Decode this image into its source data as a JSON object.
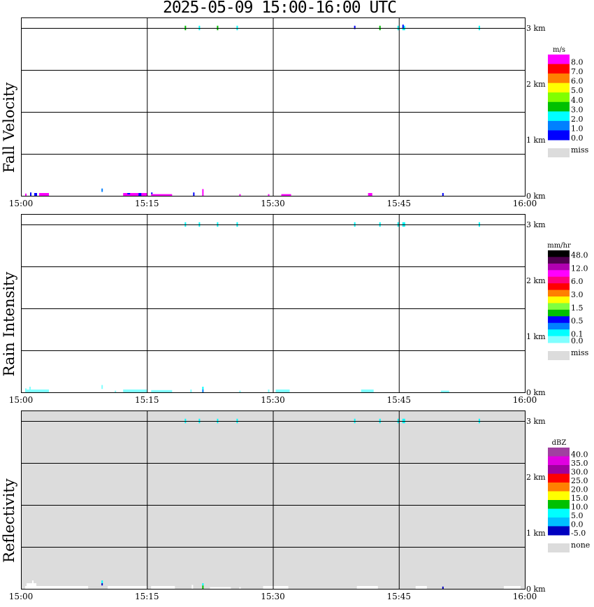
{
  "title": "2025-05-09   15:00-16:00 UTC",
  "chart_data": [
    {
      "type": "heatmap",
      "title": "Fall Velocity",
      "xlim": [
        "15:00",
        "16:00"
      ],
      "x_ticks": [
        "15:00",
        "15:15",
        "15:30",
        "15:45",
        "16:00"
      ],
      "ylim": [
        0,
        3.19
      ],
      "y_ticks": [
        "0 km",
        "1 km",
        "2 km",
        "3 km"
      ],
      "grid": true,
      "legend": {
        "unit": "m/s",
        "levels": [
          {
            "color": "#ff00ff",
            "label": "8.0",
            "min": 8
          },
          {
            "color": "#ff0000",
            "label": "7.0",
            "min": 7
          },
          {
            "color": "#ff8000",
            "label": "6.0",
            "min": 6
          },
          {
            "color": "#ffff00",
            "label": "5.0",
            "min": 5
          },
          {
            "color": "#80ff00",
            "label": "4.0",
            "min": 4
          },
          {
            "color": "#00c000",
            "label": "3.0",
            "min": 3
          },
          {
            "color": "#00ffff",
            "label": "2.0",
            "min": 2
          },
          {
            "color": "#0080ff",
            "label": "1.0",
            "min": 1
          },
          {
            "color": "#0000ff",
            "label": "0.0",
            "min": 0
          }
        ],
        "missing": {
          "color": "#dcdcdc",
          "label": "miss"
        },
        "below_color": "#ffffff"
      },
      "background": "#ffffff",
      "cells": [
        [
          "15:00:30",
          "15:00:40",
          0,
          0.04,
          8.5
        ],
        [
          "15:01:05",
          "15:01:15",
          0,
          0.06,
          0.5
        ],
        [
          "15:01:35",
          "15:01:55",
          0,
          0.05,
          0.5
        ],
        [
          "15:02:10",
          "15:03:20",
          0,
          0.05,
          8.5
        ],
        [
          "15:09:35",
          "15:09:45",
          0.07,
          0.13,
          1.5
        ],
        [
          "15:12:10",
          "15:15:00",
          0,
          0.05,
          8.5
        ],
        [
          "15:12:40",
          "15:13:00",
          0.03,
          0.05,
          0.5
        ],
        [
          "15:14:00",
          "15:14:20",
          0,
          0.05,
          0.5
        ],
        [
          "15:15:30",
          "15:18:00",
          0,
          0.03,
          8.5
        ],
        [
          "15:15:30",
          "15:15:40",
          0.03,
          0.06,
          0.5
        ],
        [
          "15:20:30",
          "15:20:40",
          0,
          0.06,
          0.5
        ],
        [
          "15:21:35",
          "15:21:45",
          0,
          0.12,
          8.5
        ],
        [
          "15:26:00",
          "15:26:10",
          0,
          0.03,
          8.5
        ],
        [
          "15:29:25",
          "15:29:35",
          0,
          0.03,
          8.5
        ],
        [
          "15:31:00",
          "15:32:10",
          0,
          0.03,
          8.5
        ],
        [
          "15:41:20",
          "15:41:50",
          0,
          0.05,
          8.5
        ],
        [
          "15:50:10",
          "15:50:20",
          0,
          0.05,
          0.5
        ],
        [
          "15:19:30",
          "15:19:40",
          2.96,
          3.04,
          3.5
        ],
        [
          "15:21:10",
          "15:21:20",
          2.96,
          3.04,
          2.5
        ],
        [
          "15:23:20",
          "15:23:30",
          2.96,
          3.04,
          3.5
        ],
        [
          "15:25:40",
          "15:25:50",
          2.96,
          3.04,
          2.5
        ],
        [
          "15:39:40",
          "15:39:50",
          2.98,
          3.04,
          0.5
        ],
        [
          "15:42:40",
          "15:42:50",
          2.96,
          3.04,
          3.5
        ],
        [
          "15:44:50",
          "15:45:00",
          2.96,
          3.04,
          2.5
        ],
        [
          "15:45:25",
          "15:45:45",
          2.96,
          3.04,
          2.5
        ],
        [
          "15:45:25",
          "15:45:35",
          3.0,
          3.06,
          0.5
        ],
        [
          "15:54:30",
          "15:54:40",
          2.96,
          3.04,
          2.5
        ]
      ]
    },
    {
      "type": "heatmap",
      "title": "Rain Intensity",
      "xlim": [
        "15:00",
        "16:00"
      ],
      "x_ticks": [
        "15:00",
        "15:15",
        "15:30",
        "15:45",
        "16:00"
      ],
      "ylim": [
        0,
        3.19
      ],
      "y_ticks": [
        "0 km",
        "1 km",
        "2 km",
        "3 km"
      ],
      "grid": true,
      "legend": {
        "unit": "mm/hr",
        "levels": [
          {
            "color": "#000000",
            "label": "48.0",
            "min": 48
          },
          {
            "color": "#500050",
            "label": "",
            "min": 24
          },
          {
            "color": "#b000b0",
            "label": "12.0",
            "min": 12
          },
          {
            "color": "#ff00ff",
            "label": "",
            "min": 9
          },
          {
            "color": "#ff0080",
            "label": "6.0",
            "min": 6
          },
          {
            "color": "#ff0000",
            "label": "",
            "min": 4.5
          },
          {
            "color": "#ff8000",
            "label": "3.0",
            "min": 3
          },
          {
            "color": "#ffff00",
            "label": "",
            "min": 2
          },
          {
            "color": "#80ff40",
            "label": "1.5",
            "min": 1.5
          },
          {
            "color": "#00c000",
            "label": "",
            "min": 1
          },
          {
            "color": "#0000ff",
            "label": "0.5",
            "min": 0.5
          },
          {
            "color": "#0080ff",
            "label": "",
            "min": 0.3
          },
          {
            "color": "#00ffff",
            "label": "0.1",
            "min": 0.1
          },
          {
            "color": "#80ffff",
            "label": "0.0",
            "min": 0
          }
        ],
        "missing": {
          "color": "#dcdcdc",
          "label": "miss"
        },
        "below_color": "#ffffff"
      },
      "background": "#ffffff",
      "cells": [
        [
          "15:00:30",
          "15:00:40",
          0,
          0.07,
          0.05
        ],
        [
          "15:00:40",
          "15:03:20",
          0,
          0.05,
          0.05
        ],
        [
          "15:01:00",
          "15:01:10",
          0.05,
          0.1,
          0.05
        ],
        [
          "15:09:35",
          "15:09:45",
          0.06,
          0.13,
          0.05
        ],
        [
          "15:11:10",
          "15:11:20",
          0,
          0.03,
          0.05
        ],
        [
          "15:12:10",
          "15:15:00",
          0,
          0.05,
          0.05
        ],
        [
          "15:15:30",
          "15:18:00",
          0,
          0.04,
          0.05
        ],
        [
          "15:20:10",
          "15:20:20",
          0,
          0.05,
          0.05
        ],
        [
          "15:21:35",
          "15:21:45",
          0,
          0.05,
          0.4
        ],
        [
          "15:21:35",
          "15:21:45",
          0.05,
          0.1,
          0.2
        ],
        [
          "15:26:00",
          "15:26:10",
          0,
          0.03,
          0.05
        ],
        [
          "15:29:25",
          "15:29:35",
          0,
          0.05,
          0.05
        ],
        [
          "15:30:20",
          "15:32:00",
          0,
          0.05,
          0.05
        ],
        [
          "15:40:30",
          "15:42:00",
          0,
          0.05,
          0.05
        ],
        [
          "15:50:00",
          "15:51:00",
          0,
          0.03,
          0.05
        ],
        [
          "15:19:30",
          "15:19:40",
          2.96,
          3.04,
          0.2
        ],
        [
          "15:21:10",
          "15:21:20",
          2.96,
          3.04,
          0.2
        ],
        [
          "15:23:20",
          "15:23:30",
          2.96,
          3.04,
          0.2
        ],
        [
          "15:25:40",
          "15:25:50",
          2.96,
          3.04,
          0.2
        ],
        [
          "15:39:40",
          "15:39:50",
          2.96,
          3.04,
          0.2
        ],
        [
          "15:42:40",
          "15:42:50",
          2.96,
          3.04,
          0.2
        ],
        [
          "15:44:50",
          "15:45:00",
          2.96,
          3.04,
          0.2
        ],
        [
          "15:45:25",
          "15:45:45",
          2.96,
          3.04,
          0.2
        ],
        [
          "15:54:30",
          "15:54:40",
          2.96,
          3.04,
          0.2
        ]
      ]
    },
    {
      "type": "heatmap",
      "title": "Reflectivity",
      "xlim": [
        "15:00",
        "16:00"
      ],
      "x_ticks": [
        "15:00",
        "15:15",
        "15:30",
        "15:45",
        "16:00"
      ],
      "ylim": [
        0,
        3.19
      ],
      "y_ticks": [
        "0 km",
        "1 km",
        "2 km",
        "3 km"
      ],
      "grid": true,
      "legend": {
        "unit": "dBZ",
        "levels": [
          {
            "color": "#a040a0",
            "label": "40.0",
            "min": 40
          },
          {
            "color": "#e000e0",
            "label": "35.0",
            "min": 35
          },
          {
            "color": "#a000a0",
            "label": "30.0",
            "min": 30
          },
          {
            "color": "#ff0000",
            "label": "25.0",
            "min": 25
          },
          {
            "color": "#ff8000",
            "label": "20.0",
            "min": 20
          },
          {
            "color": "#ffff00",
            "label": "15.0",
            "min": 15
          },
          {
            "color": "#00c000",
            "label": "10.0",
            "min": 10
          },
          {
            "color": "#00ffff",
            "label": "5.0",
            "min": 5
          },
          {
            "color": "#00c0ff",
            "label": "0.0",
            "min": 0
          },
          {
            "color": "#0000c0",
            "label": "-5.0",
            "min": -5
          }
        ],
        "missing": {
          "color": "#dcdcdc",
          "label": "none"
        },
        "below_color": "#ffffff"
      },
      "background": "#dcdcdc",
      "cells": [
        [
          "15:00:30",
          "15:08:00",
          0,
          0.05,
          -10
        ],
        [
          "15:00:40",
          "15:01:50",
          0.05,
          0.1,
          -10
        ],
        [
          "15:01:20",
          "15:01:30",
          0.1,
          0.15,
          -10
        ],
        [
          "15:10:20",
          "15:15:00",
          0,
          0.05,
          -10
        ],
        [
          "15:09:35",
          "15:09:45",
          0.06,
          0.1,
          -2
        ],
        [
          "15:09:35",
          "15:09:45",
          0.1,
          0.15,
          7
        ],
        [
          "15:15:30",
          "15:18:20",
          0,
          0.05,
          -10
        ],
        [
          "15:20:20",
          "15:20:30",
          0,
          0.07,
          -10
        ],
        [
          "15:21:35",
          "15:21:45",
          0,
          0.06,
          12
        ],
        [
          "15:21:35",
          "15:21:45",
          0.06,
          0.1,
          7
        ],
        [
          "15:22:30",
          "15:25:00",
          0,
          0.03,
          -10
        ],
        [
          "15:26:00",
          "15:26:10",
          0,
          0.03,
          -10
        ],
        [
          "15:28:50",
          "15:31:50",
          0,
          0.05,
          -10
        ],
        [
          "15:40:00",
          "15:42:30",
          0,
          0.05,
          -10
        ],
        [
          "15:47:00",
          "15:48:20",
          0,
          0.05,
          -10
        ],
        [
          "15:50:10",
          "15:50:20",
          0,
          0.04,
          -2
        ],
        [
          "15:57:30",
          "15:59:30",
          0,
          0.05,
          -10
        ],
        [
          "15:19:30",
          "15:19:40",
          2.96,
          3.04,
          7
        ],
        [
          "15:21:10",
          "15:21:20",
          2.96,
          3.04,
          7
        ],
        [
          "15:23:20",
          "15:23:30",
          2.96,
          3.04,
          7
        ],
        [
          "15:25:40",
          "15:25:50",
          2.96,
          3.04,
          7
        ],
        [
          "15:39:40",
          "15:39:50",
          2.96,
          3.04,
          7
        ],
        [
          "15:42:40",
          "15:42:50",
          2.96,
          3.04,
          7
        ],
        [
          "15:44:50",
          "15:45:00",
          2.96,
          3.04,
          7
        ],
        [
          "15:45:25",
          "15:45:45",
          2.96,
          3.04,
          7
        ],
        [
          "15:54:30",
          "15:54:40",
          2.96,
          3.04,
          7
        ]
      ]
    }
  ]
}
